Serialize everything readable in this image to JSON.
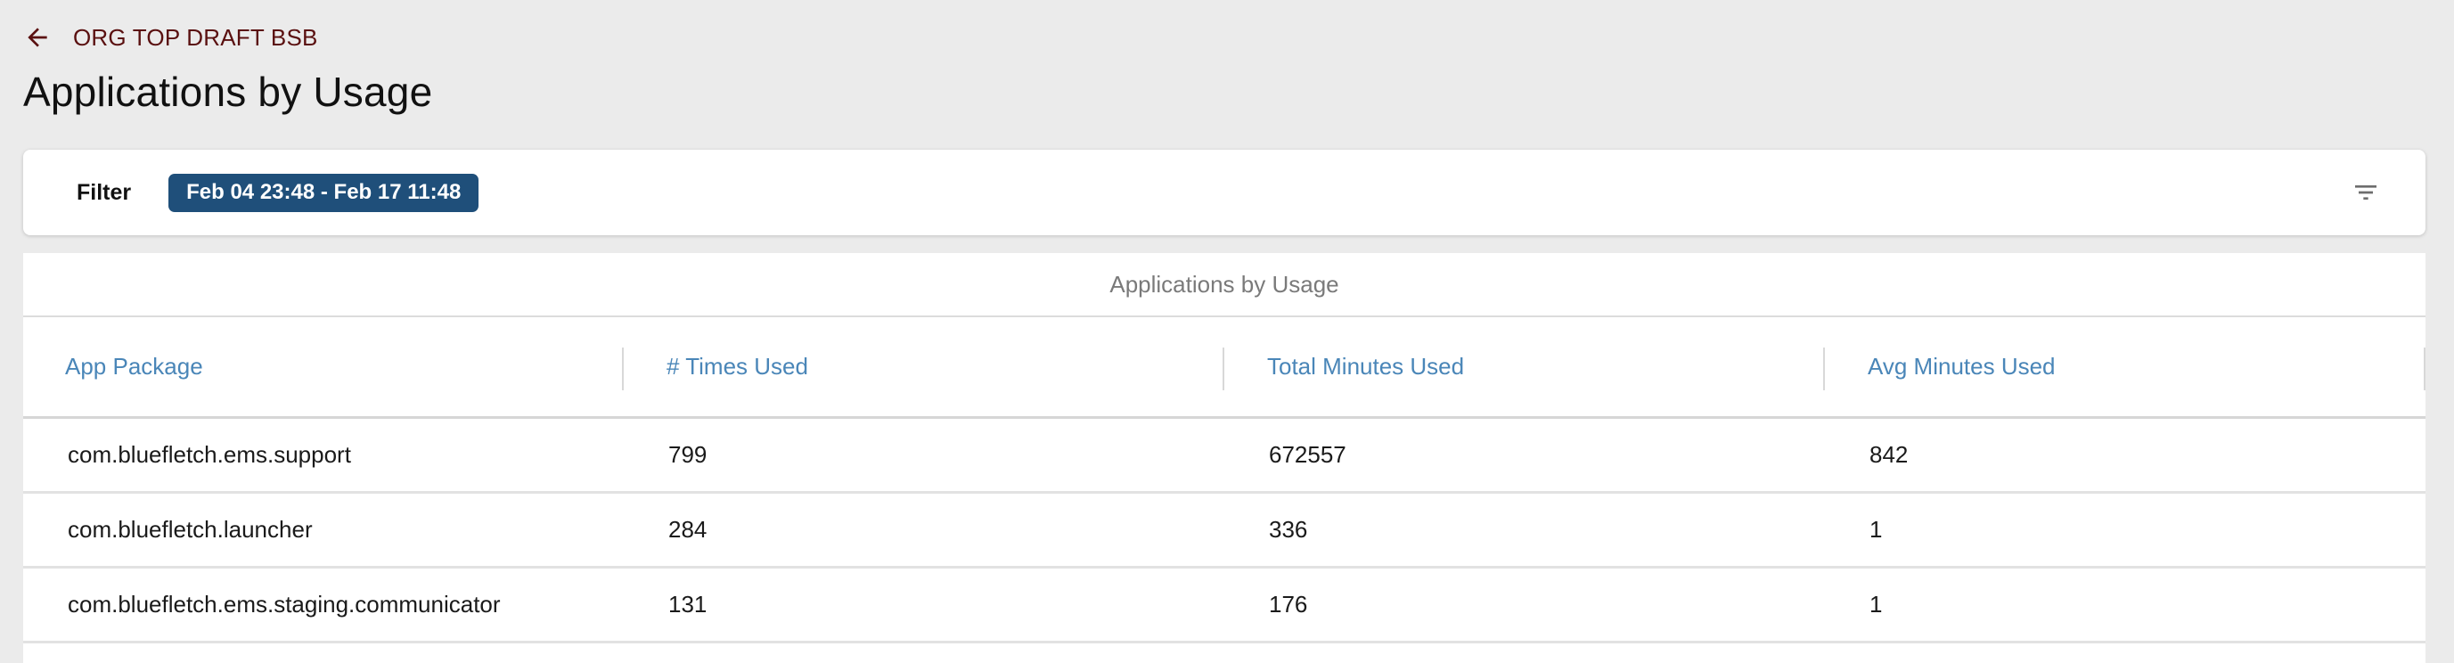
{
  "breadcrumb": {
    "icon": "arrow-left-icon",
    "label": "ORG TOP DRAFT BSB"
  },
  "page": {
    "title": "Applications by Usage"
  },
  "filter": {
    "label": "Filter",
    "chip": "Feb 04 23:48 - Feb 17 11:48",
    "chip_color": "#1f4f7a",
    "icon": "filter-list-icon"
  },
  "table": {
    "caption": "Applications by Usage",
    "columns": [
      "App Package",
      "# Times Used",
      "Total Minutes Used",
      "Avg Minutes Used"
    ],
    "rows": [
      [
        "com.bluefletch.ems.support",
        "799",
        "672557",
        "842"
      ],
      [
        "com.bluefletch.launcher",
        "284",
        "336",
        "1"
      ],
      [
        "com.bluefletch.ems.staging.communicator",
        "131",
        "176",
        "1"
      ]
    ],
    "header_color": "#4a86b8"
  }
}
